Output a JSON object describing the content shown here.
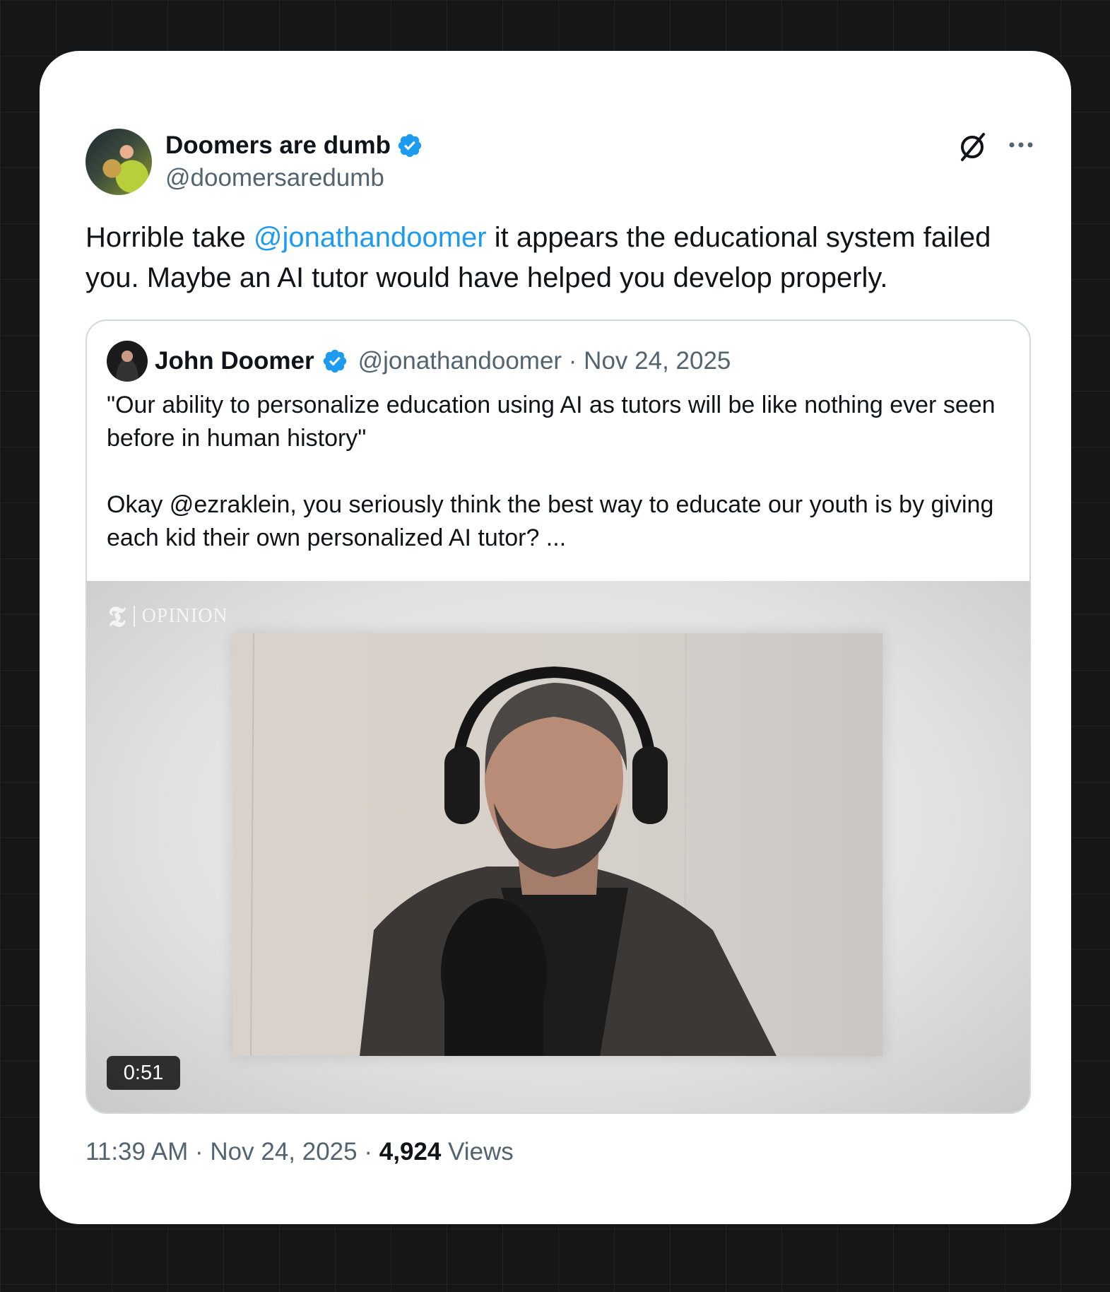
{
  "tweet": {
    "display_name": "Doomers are dumb",
    "handle": "@doomersaredumb",
    "text_before": "Horrible take ",
    "mention": "@jonathandoomer",
    "text_after": " it appears the educational system failed you. Maybe an AI tutor would have helped you develop properly.",
    "time": "11:39 AM",
    "separator": "·",
    "date": "Nov 24, 2025",
    "views_count": "4,924",
    "views_label": "Views"
  },
  "quote": {
    "display_name": "John Doomer",
    "handle_date": "@jonathandoomer · Nov 24, 2025",
    "paragraph1": "\"Our ability to personalize education using AI as tutors will be like nothing ever seen before in human history\"",
    "paragraph2": "Okay @ezraklein, you seriously think the best way to educate our youth is by giving each kid their own personalized AI tutor? ...",
    "video": {
      "watermark_label": "OPINION",
      "duration": "0:51"
    }
  },
  "icons": {
    "verified": "verified-badge-icon",
    "grok": "grok-icon",
    "more": "more-options-icon"
  },
  "colors": {
    "accent": "#1d9bf0",
    "text_primary": "#0f1419",
    "text_secondary": "#536471",
    "border": "#cfd9de",
    "background": "#141617",
    "card": "#ffffff"
  }
}
